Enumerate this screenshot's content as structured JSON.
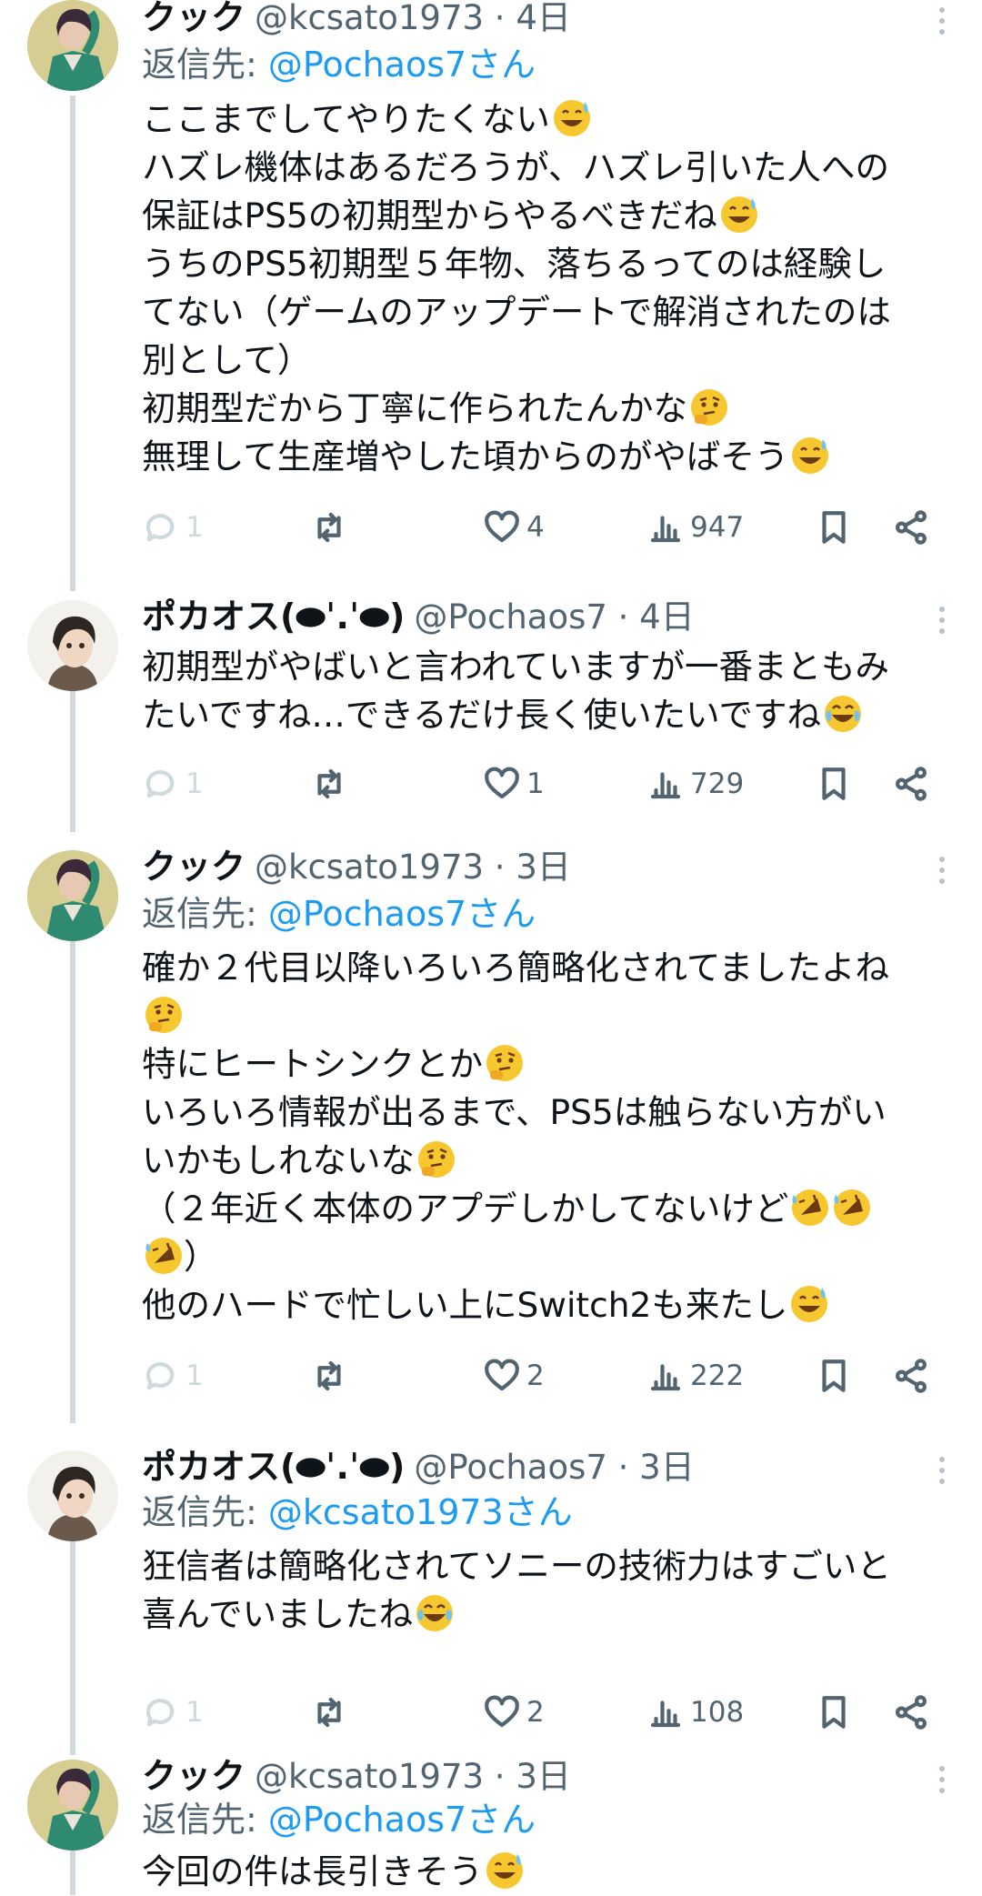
{
  "colors": {
    "mention": "#1d9bf0",
    "secondary": "#536471",
    "thread_line": "#cfd9de"
  },
  "tweets": [
    {
      "name": "クック",
      "handle": "@kcsato1973 · 4日",
      "reply_prefix": "返信先: ",
      "reply_to": "@Pochaos7さん",
      "lines": [
        "ここまでしてやりたくない😅",
        "ハズレ機体はあるだろうが、ハズレ引いた人への",
        "保証はPS5の初期型からやるべきだね😅",
        "うちのPS5初期型５年物、落ちるってのは経験し",
        "てない（ゲームのアップデートで解消されたのは",
        "別として）",
        "初期型だから丁寧に作られたんかな🤔",
        "無理して生産増やした頃からのがやばそう😅"
      ],
      "replies": "1",
      "retweets": "",
      "likes": "4",
      "views": "947"
    },
    {
      "name": "ポカオス(⬬ˈ.ˈ⬬)",
      "handle": "@Pochaos7 · 4日",
      "reply_prefix": "",
      "reply_to": "",
      "lines": [
        "初期型がやばいと言われていますが一番まともみ",
        "たいですね…できるだけ長く使いたいですね😂"
      ],
      "replies": "1",
      "retweets": "",
      "likes": "1",
      "views": "729"
    },
    {
      "name": "クック",
      "handle": "@kcsato1973 · 3日",
      "reply_prefix": "返信先: ",
      "reply_to": "@Pochaos7さん",
      "lines": [
        "確か２代目以降いろいろ簡略化されてましたよね",
        "🤔",
        "特にヒートシンクとか🤔",
        "いろいろ情報が出るまで、PS5は触らない方がい",
        "いかもしれないな🤔",
        "（２年近く本体のアプデしかしてないけど🤣🤣",
        "🤣）",
        "他のハードで忙しい上にSwitch2も来たし😅"
      ],
      "replies": "1",
      "retweets": "",
      "likes": "2",
      "views": "222"
    },
    {
      "name": "ポカオス(⬬ˈ.ˈ⬬)",
      "handle": "@Pochaos7 · 3日",
      "reply_prefix": "返信先: ",
      "reply_to": "@kcsato1973さん",
      "lines": [
        "狂信者は簡略化されてソニーの技術力はすごいと",
        "喜んでいましたね😂"
      ],
      "replies": "1",
      "retweets": "",
      "likes": "2",
      "views": "108"
    },
    {
      "name": "クック",
      "handle": "@kcsato1973 · 3日",
      "reply_prefix": "返信先: ",
      "reply_to": "@Pochaos7さん",
      "lines": [
        "今回の件は長引きそう😅"
      ]
    }
  ]
}
